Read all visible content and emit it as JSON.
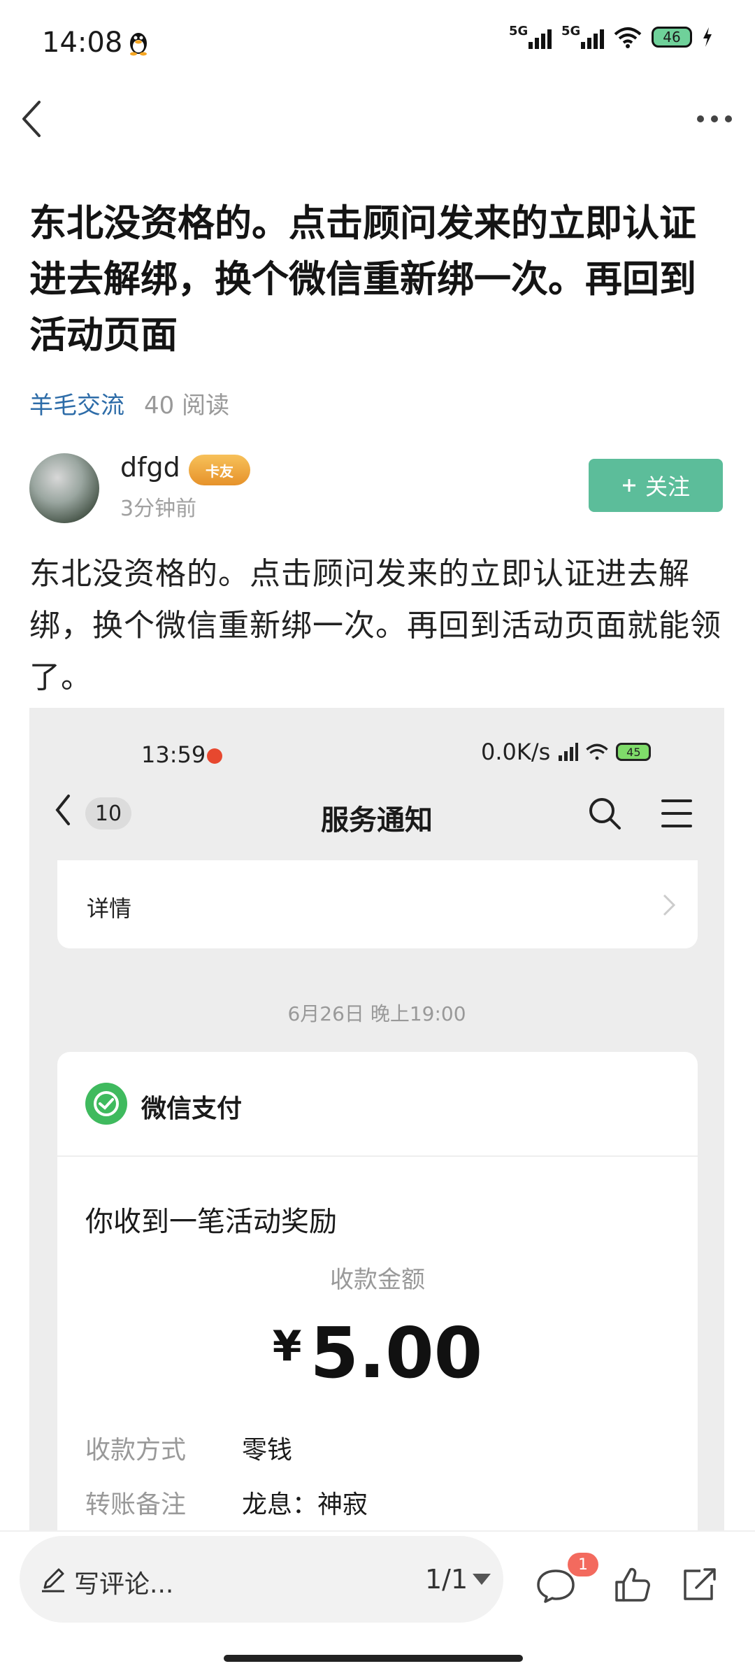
{
  "status_bar": {
    "time": "14:08",
    "network_1": "5G",
    "network_2": "5G",
    "battery": "46"
  },
  "post": {
    "title": "东北没资格的。点击顾问发来的立即认证进去解绑，换个微信重新绑一次。再回到活动页面",
    "tag": "羊毛交流",
    "reads": "40 阅读",
    "author": "dfgd",
    "badge": "卡友",
    "time_ago": "3分钟前",
    "follow_label": "关注",
    "body": "东北没资格的。点击顾问发来的立即认证进去解绑，换个微信重新绑一次。再回到活动页面就能领了。"
  },
  "screenshot": {
    "status_time": "13:59",
    "status_speed": "0.0K/s",
    "status_battery": "45",
    "unread_count": "10",
    "page_title": "服务通知",
    "details_label": "详情",
    "date": "6月26日 晚上19:00",
    "sender": "微信支付",
    "message": "你收到一笔活动奖励",
    "amount_label": "收款金额",
    "currency": "¥",
    "amount": "5.00",
    "rows": [
      {
        "key": "收款方式",
        "value": "零钱"
      },
      {
        "key": "转账备注",
        "value": "龙息：神寂"
      }
    ]
  },
  "bottom_bar": {
    "comment_placeholder": "写评论...",
    "pager": "1/1",
    "comment_badge": "1"
  }
}
